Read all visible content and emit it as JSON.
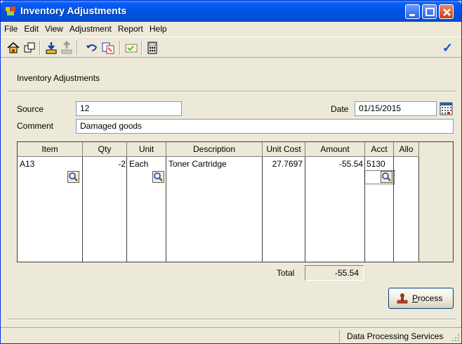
{
  "window": {
    "title": "Inventory Adjustments"
  },
  "menu": [
    "File",
    "Edit",
    "View",
    "Adjustment",
    "Report",
    "Help"
  ],
  "toolbar_icons": [
    "home-icon",
    "copy-icon",
    "download-icon",
    "upload-icon",
    "undo-icon",
    "report-icon",
    "card-icon",
    "calculator-icon",
    "checkmark-icon"
  ],
  "heading": "Inventory Adjustments",
  "form": {
    "source_label": "Source",
    "source_value": "12",
    "date_label": "Date",
    "date_value": "01/15/2015",
    "comment_label": "Comment",
    "comment_value": "Damaged goods"
  },
  "grid": {
    "columns": [
      "Item",
      "Qty",
      "Unit",
      "Description",
      "Unit Cost",
      "Amount",
      "Acct",
      "Allo"
    ],
    "rows": [
      {
        "item": "A13",
        "qty": "-2",
        "unit": "Each",
        "description": "Toner Cartridge",
        "unit_cost": "27.7697",
        "amount": "-55.54",
        "acct": "5130",
        "allo": ""
      }
    ]
  },
  "total": {
    "label": "Total",
    "value": "-55.54"
  },
  "process_button": {
    "label": "Process"
  },
  "status": {
    "text": "Data Processing Services"
  },
  "colors": {
    "titlebar": "#0053e1",
    "panel": "#ece9d8"
  }
}
